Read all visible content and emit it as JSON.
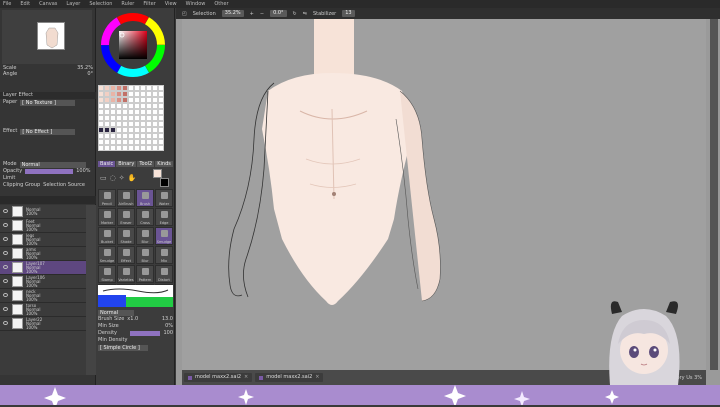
{
  "menu": [
    "File",
    "Edit",
    "Canvas",
    "Layer",
    "Selection",
    "Ruler",
    "Filter",
    "View",
    "Window",
    "Other"
  ],
  "toolbar": {
    "selection_label": "Selection",
    "zoom": "35.2%",
    "angle": "0.0°",
    "stabilizer_label": "Stabilizer",
    "stabilizer_value": "13"
  },
  "navigator": {
    "scale_label": "Scale",
    "scale_value": "35.2%",
    "angle_label": "Angle",
    "angle_value": "0°"
  },
  "layer_effect": {
    "title": "Layer Effect",
    "paper_label": "Paper",
    "paper_value": "[ No Texture ]",
    "effect_label": "Effect",
    "effect_value": "[ No Effect ]"
  },
  "layer_props": {
    "mode_label": "Mode",
    "mode_value": "Normal",
    "opacity_label": "Opacity",
    "opacity_value": "100%",
    "opacity_level": 1.0,
    "limit_label": "Limit",
    "clipping_label": "Clipping Group",
    "source_label": "Selection Source"
  },
  "layers": [
    {
      "name": "",
      "mode": "Normal",
      "opacity": "100%",
      "selected": false
    },
    {
      "name": "Feet",
      "mode": "Normal",
      "opacity": "100%",
      "selected": false
    },
    {
      "name": "legs",
      "mode": "Normal",
      "opacity": "100%",
      "selected": false
    },
    {
      "name": "arms",
      "mode": "Normal",
      "opacity": "100%",
      "selected": false
    },
    {
      "name": "Layer107",
      "mode": "Normal",
      "opacity": "100%",
      "selected": true
    },
    {
      "name": "Layer106",
      "mode": "Normal",
      "opacity": "100%",
      "selected": false
    },
    {
      "name": "neck",
      "mode": "Normal",
      "opacity": "100%",
      "selected": false
    },
    {
      "name": "torso",
      "mode": "Normal",
      "opacity": "100%",
      "selected": false
    },
    {
      "name": "Layer22",
      "mode": "Normal",
      "opacity": "100%",
      "selected": false
    }
  ],
  "tool_tabs": [
    "Basic",
    "Binary",
    "Tool2",
    "Kinds"
  ],
  "tools": [
    "Pencil",
    "AirBrush",
    "Brush",
    "Water",
    "Marker",
    "Eraser",
    "Cross",
    "Edge",
    "Bucket",
    "Shade",
    "Blur",
    "Smudge",
    "Smudge",
    "Effect",
    "Blur",
    "Mix",
    "Stamp",
    "Varieties",
    "Pattern",
    "Distort",
    "Brush",
    "Pen",
    "Bubble",
    "Brush2"
  ],
  "brush": {
    "mode_value": "Normal",
    "size_label": "Brush Size",
    "size_mult": "x1.0",
    "size_value": "13.0",
    "min_size_label": "Min Size",
    "min_size_value": "0%",
    "density_label": "Density",
    "density_value": "100",
    "min_density_label": "Min Density",
    "shape_value": "[ Simple Circle ]"
  },
  "file_tabs": [
    "model maxx2.sai2",
    "model maxx2.sai2"
  ],
  "status": {
    "memory_label": "Memory Us",
    "memory_value": "3%"
  },
  "colors": {
    "accent": "#8f72c0",
    "stripe": "#a98ccf",
    "skin": "#f7e3d8"
  }
}
